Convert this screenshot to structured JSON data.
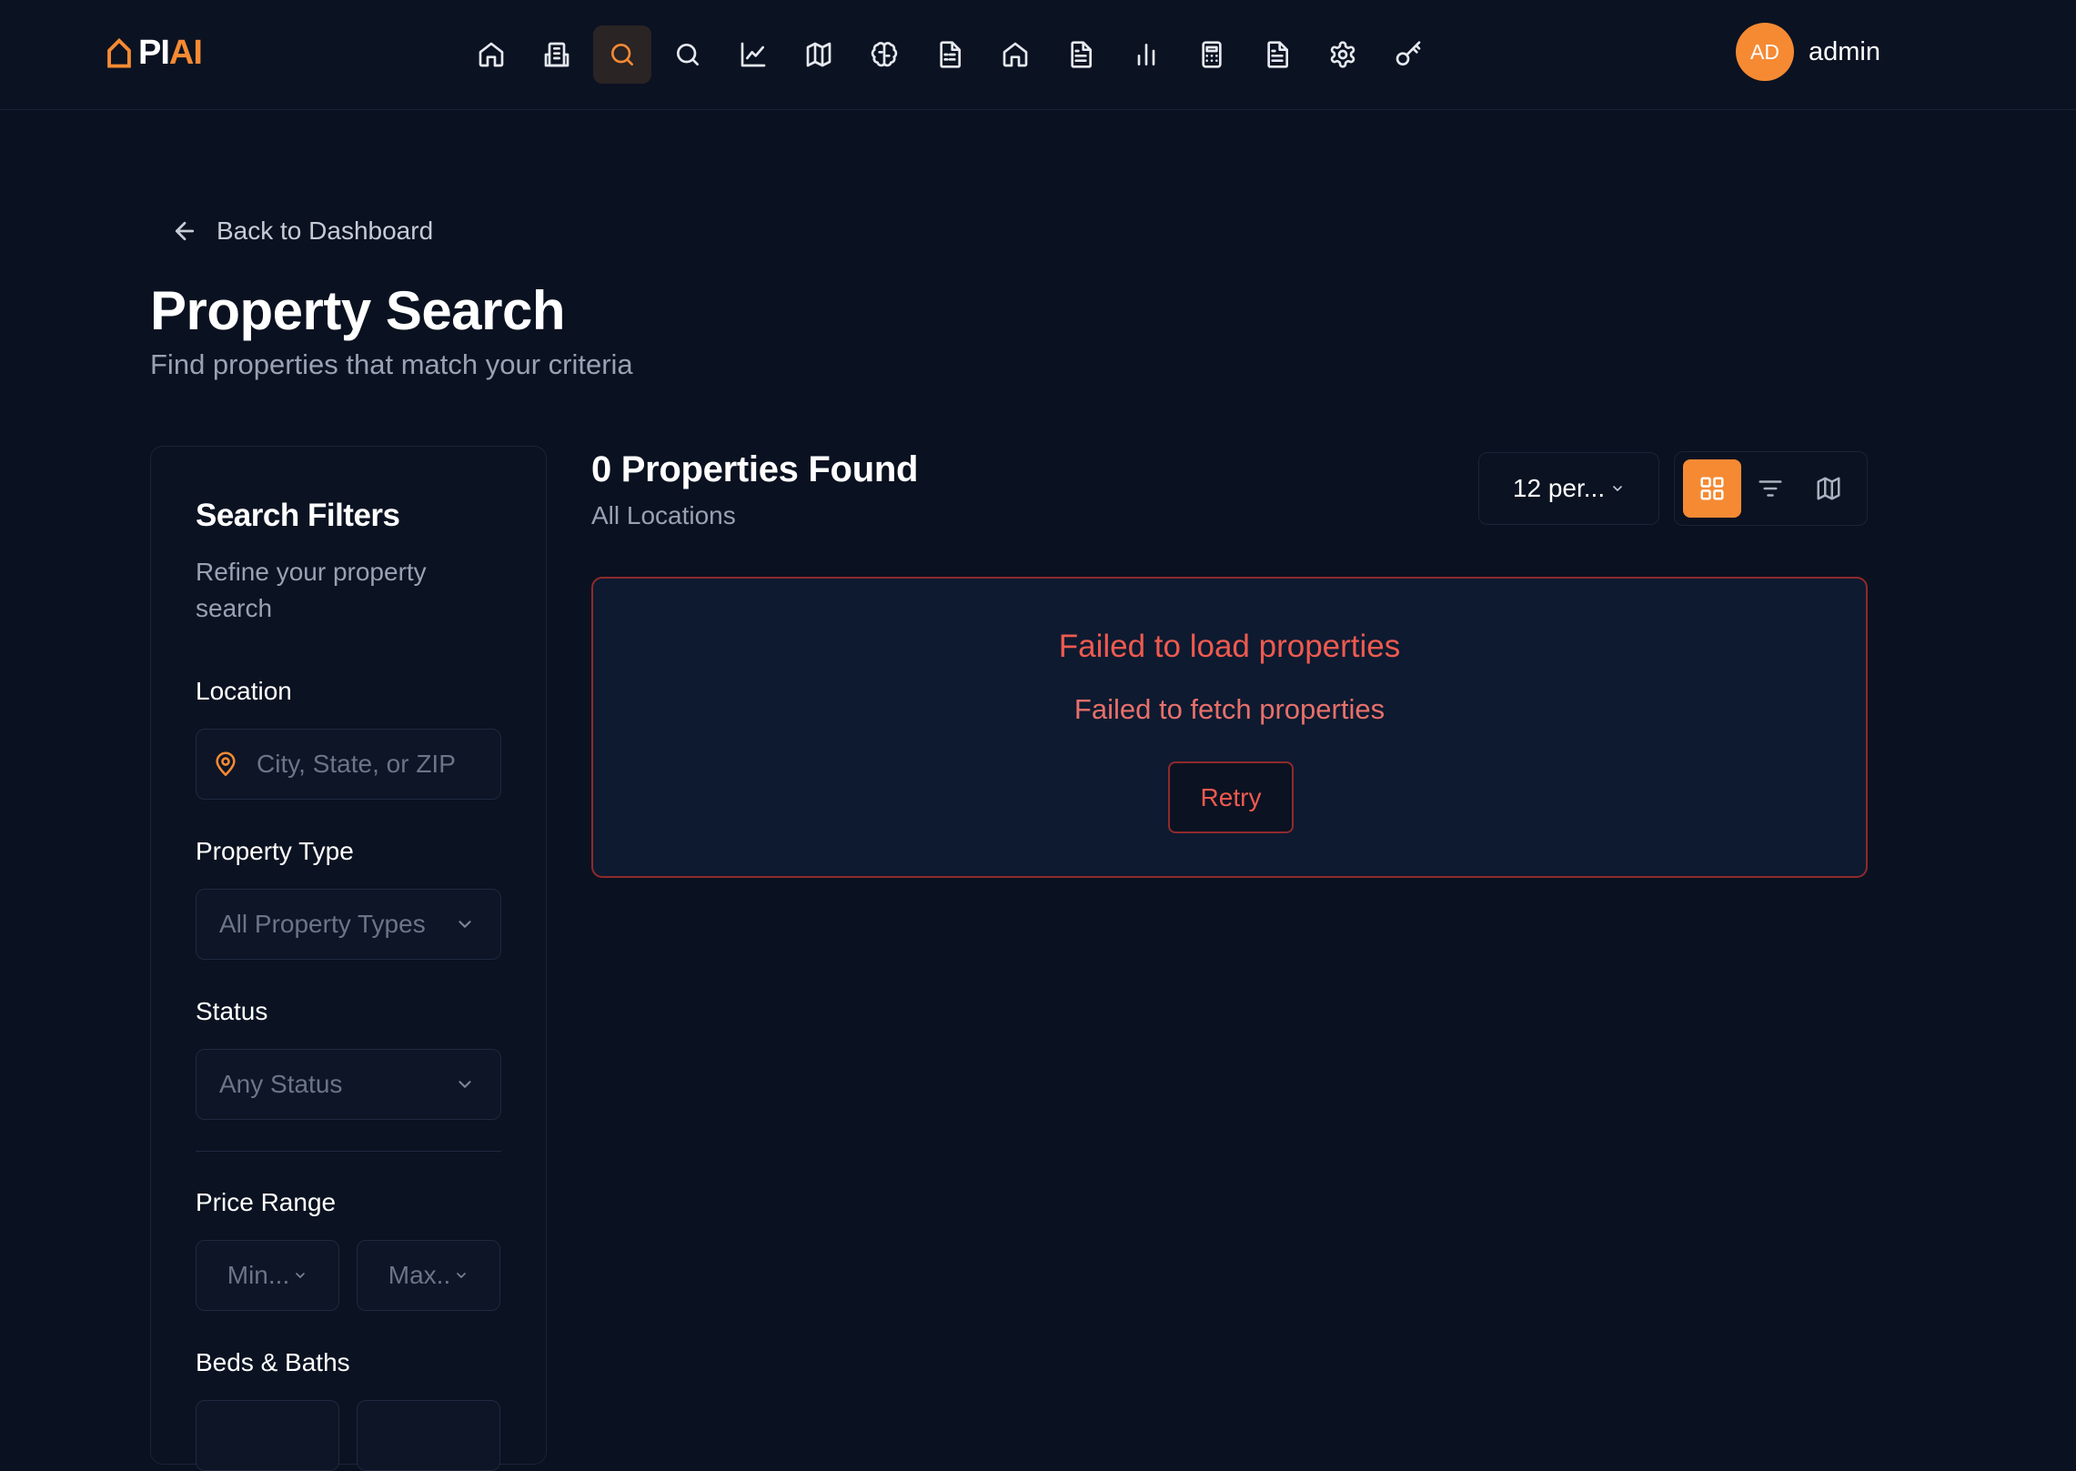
{
  "brand": {
    "name_part1": "PI",
    "name_part2": "AI",
    "accent_color": "#f58a33",
    "logo_icon": "house-outline-icon"
  },
  "nav": {
    "icons": [
      "home-icon",
      "building-icon",
      "search-icon",
      "search-icon",
      "chart-line-icon",
      "map-icon",
      "brain-icon",
      "spreadsheet-icon",
      "house-icon",
      "document-icon",
      "bar-chart-icon",
      "calculator-icon",
      "file-text-icon",
      "gear-icon",
      "key-icon"
    ],
    "active_index": 2
  },
  "user": {
    "initials": "AD",
    "name": "admin"
  },
  "header": {
    "back_label": "Back to Dashboard",
    "title": "Property Search",
    "subtitle": "Find properties that match your criteria"
  },
  "filters": {
    "title": "Search Filters",
    "description": "Refine your property search",
    "location_label": "Location",
    "location_placeholder": "City, State, or ZIP",
    "type_label": "Property Type",
    "type_value": "All Property Types",
    "status_label": "Status",
    "status_value": "Any Status",
    "price_label": "Price Range",
    "price_min": "Min...",
    "price_max": "Max..",
    "beds_label": "Beds & Baths"
  },
  "results": {
    "count_text": "0 Properties Found",
    "location_text": "All Locations",
    "per_page": "12 per...",
    "views": [
      "grid-view-icon",
      "list-filter-icon",
      "map-view-icon"
    ],
    "active_view": 0
  },
  "error": {
    "title": "Failed to load properties",
    "message": "Failed to fetch properties",
    "retry_label": "Retry",
    "color": "#ef5a4f"
  }
}
